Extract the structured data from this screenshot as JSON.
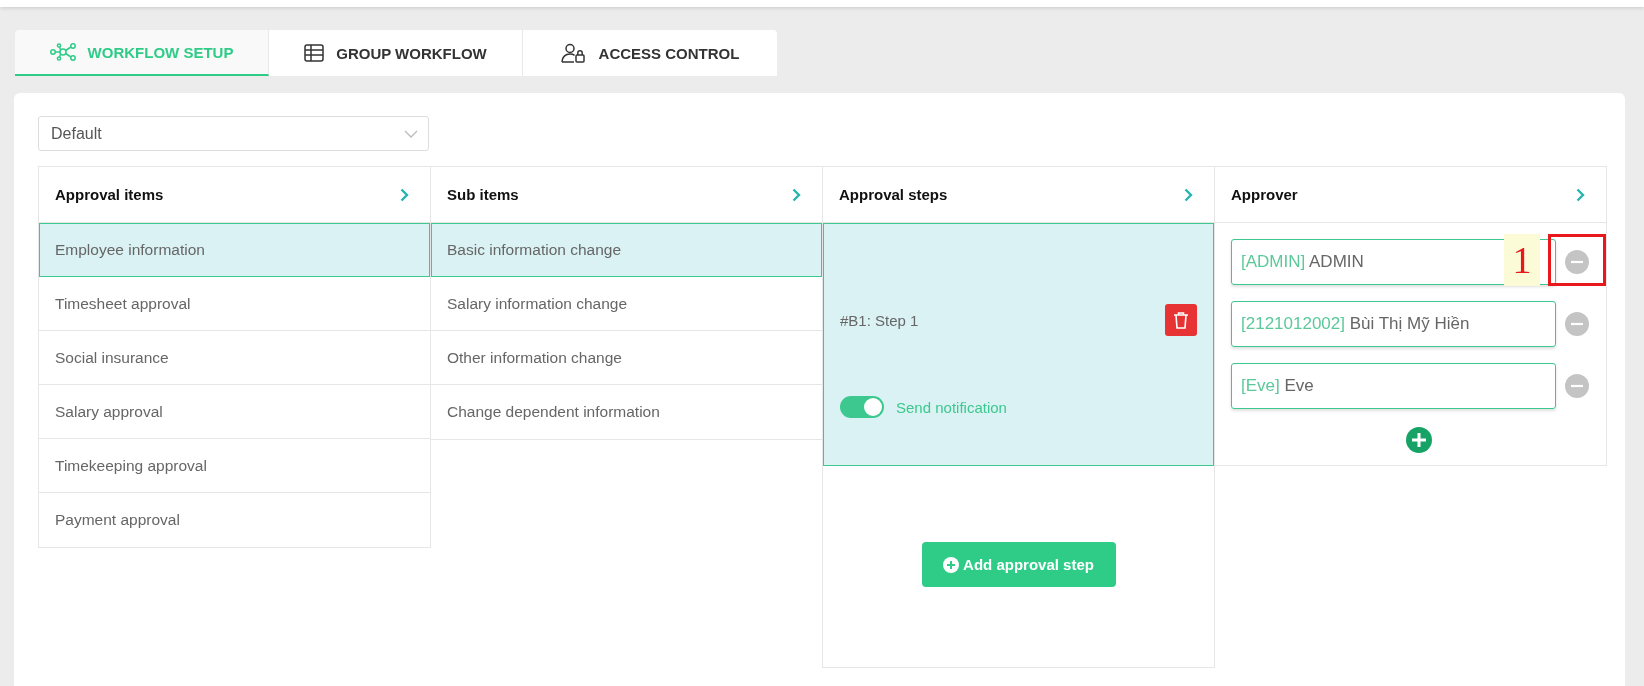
{
  "tabs": [
    {
      "label": "WORKFLOW SETUP",
      "selected": true
    },
    {
      "label": "GROUP WORKFLOW",
      "selected": false
    },
    {
      "label": "ACCESS CONTROL",
      "selected": false
    }
  ],
  "workflow_select": {
    "value": "Default"
  },
  "approval_items": {
    "title": "Approval items",
    "items": [
      {
        "label": "Employee information",
        "selected": true
      },
      {
        "label": "Timesheet approval",
        "selected": false
      },
      {
        "label": "Social insurance",
        "selected": false
      },
      {
        "label": "Salary approval",
        "selected": false
      },
      {
        "label": "Timekeeping approval",
        "selected": false
      },
      {
        "label": "Payment approval",
        "selected": false
      }
    ]
  },
  "sub_items": {
    "title": "Sub items",
    "items": [
      {
        "label": "Basic information change",
        "selected": true
      },
      {
        "label": "Salary information change",
        "selected": false
      },
      {
        "label": "Other information change",
        "selected": false
      },
      {
        "label": "Change dependent information",
        "selected": false
      }
    ]
  },
  "approval_steps": {
    "title": "Approval steps",
    "steps": [
      {
        "label": "#B1: Step 1",
        "selected": true,
        "notification": {
          "label": "Send notification",
          "on": true
        }
      }
    ],
    "add_button": "Add approval step"
  },
  "approver": {
    "title": "Approver",
    "approvers": [
      {
        "code": "[ADMIN]",
        "name": "ADMIN",
        "callout": "1"
      },
      {
        "code": "[2121012002]",
        "name": "Bùi Thị Mỹ Hiền"
      },
      {
        "code": "[Eve]",
        "name": "Eve"
      }
    ]
  }
}
